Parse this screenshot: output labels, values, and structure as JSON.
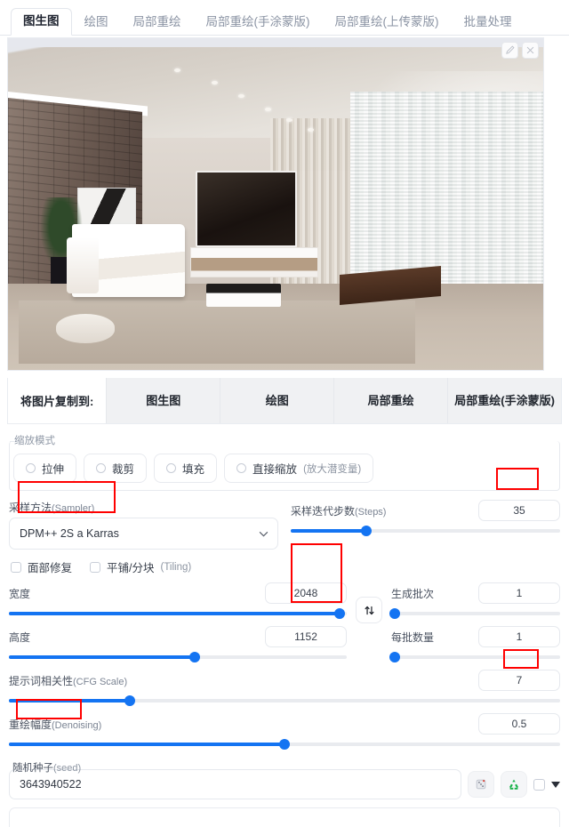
{
  "tabs": [
    {
      "label": "图生图",
      "active": true
    },
    {
      "label": "绘图",
      "active": false
    },
    {
      "label": "局部重绘",
      "active": false
    },
    {
      "label": "局部重绘(手涂蒙版)",
      "active": false
    },
    {
      "label": "局部重绘(上传蒙版)",
      "active": false
    },
    {
      "label": "批量处理",
      "active": false
    }
  ],
  "image_panel": {
    "alt": "现代客厅室内照片：左侧砖墙、白色沙发、电视柜、纱帘落地窗、米色地毯",
    "edit_icon": "pencil-icon",
    "close_icon": "close-icon"
  },
  "copy_to": {
    "label": "将图片复制到:",
    "buttons": [
      "图生图",
      "绘图",
      "局部重绘",
      "局部重绘(手涂蒙版)"
    ]
  },
  "resize_mode": {
    "legend": "缩放模式",
    "options": [
      {
        "label": "拉伸",
        "note": "",
        "selected": false
      },
      {
        "label": "裁剪",
        "note": "",
        "selected": false
      },
      {
        "label": "填充",
        "note": "",
        "selected": false
      },
      {
        "label": "直接缩放",
        "note": "(放大潜变量)",
        "selected": false
      }
    ]
  },
  "sampler": {
    "label_cn": "采样方法",
    "label_en": "(Sampler)",
    "value": "DPM++ 2S a Karras",
    "chevron_icon": "chevron-down-icon"
  },
  "steps": {
    "label_cn": "采样迭代步数",
    "label_en": "(Steps)",
    "value": "35",
    "percent": 28,
    "highlighted": true
  },
  "checkboxes": [
    {
      "label": "面部修复",
      "note": "",
      "checked": false
    },
    {
      "label": "平铺/分块",
      "note": "(Tiling)",
      "checked": false
    }
  ],
  "width": {
    "label": "宽度",
    "value": "2048",
    "percent": 98,
    "highlighted": true
  },
  "height": {
    "label": "高度",
    "value": "1152",
    "percent": 55,
    "highlighted": true
  },
  "swap": {
    "icon": "swap-vertical-icon",
    "tooltip": "交换宽高"
  },
  "batch_count": {
    "label": "生成批次",
    "value": "1",
    "percent": 2
  },
  "batch_size": {
    "label": "每批数量",
    "value": "1",
    "percent": 2
  },
  "cfg": {
    "label_cn": "提示词相关性",
    "label_en": "(CFG Scale)",
    "value": "7",
    "percent": 22,
    "highlighted": false
  },
  "denoising": {
    "label_cn": "重绘幅度",
    "label_en": "(Denoising)",
    "value": "0.5",
    "percent": 50,
    "highlighted": true
  },
  "seed": {
    "label_cn": "随机种子",
    "label_en": "(seed)",
    "value": "3643940522",
    "highlighted": true,
    "dice_icon": "dice-icon",
    "recycle_icon": "recycle-icon",
    "extra_checkbox_checked": false,
    "expand_icon": "triangle-down-icon"
  },
  "colors": {
    "accent": "#1474f2",
    "highlight": "#ff0000",
    "recycle_green": "#19b24a",
    "tab_inactive": "#8a93a3",
    "border": "#e6e9ee"
  }
}
